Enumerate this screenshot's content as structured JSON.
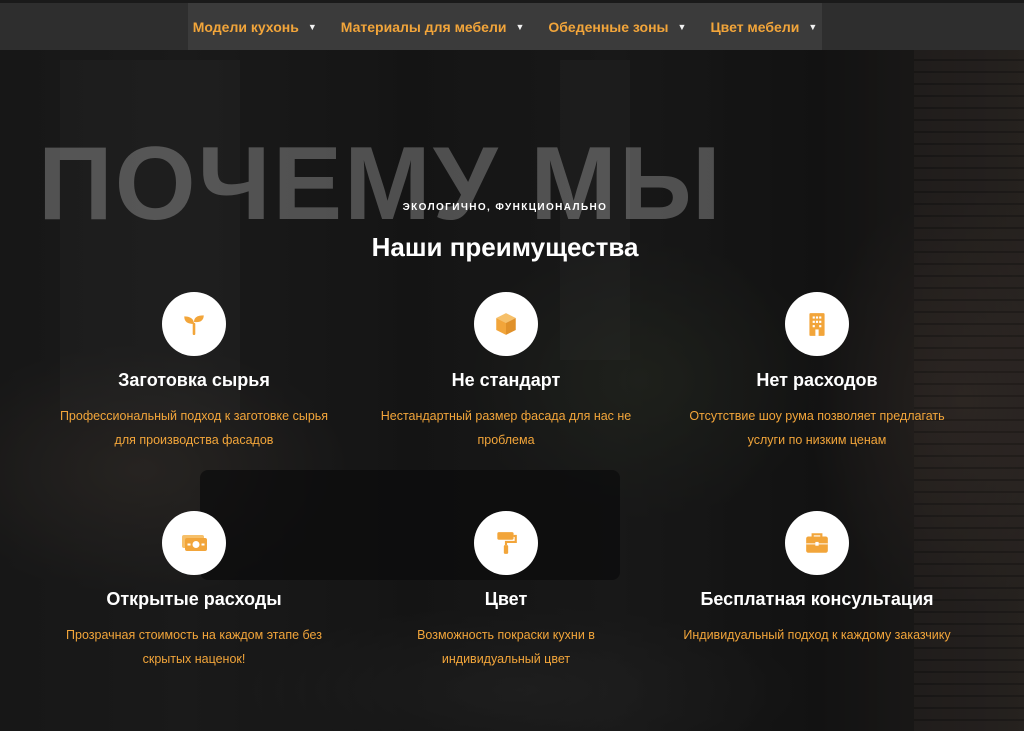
{
  "colors": {
    "accent": "#f2a53a",
    "nav_bg": "#3b3b3b",
    "text_light": "#ffffff"
  },
  "nav": {
    "items": [
      {
        "label": "Модели кухонь"
      },
      {
        "label": "Материалы для мебели"
      },
      {
        "label": "Обеденные зоны"
      },
      {
        "label": "Цвет мебели"
      }
    ]
  },
  "section": {
    "watermark": "ПОЧЕМУ МЫ",
    "subtitle": "экологично, функционально",
    "title": "Наши преимущества"
  },
  "features": [
    {
      "icon": "seedling-icon",
      "title": "Заготовка сырья",
      "text": "Профессиональный подход к заготовке сырья для производства фасадов"
    },
    {
      "icon": "box-icon",
      "title": "Не стандарт",
      "text": "Нестандартный размер фасада для нас не проблема"
    },
    {
      "icon": "building-icon",
      "title": "Нет расходов",
      "text": "Отсутствие шоу рума позволяет предлагать услуги по низким ценам"
    },
    {
      "icon": "money-icon",
      "title": "Открытые расходы",
      "text": "Прозрачная стоимость на каждом этапе без скрытых наценок!"
    },
    {
      "icon": "paint-roller-icon",
      "title": "Цвет",
      "text": "Возможность покраски кухни в индивидуальный цвет"
    },
    {
      "icon": "briefcase-icon",
      "title": "Бесплатная консультация",
      "text": "Индивидуальный подход к каждому заказчику"
    }
  ]
}
